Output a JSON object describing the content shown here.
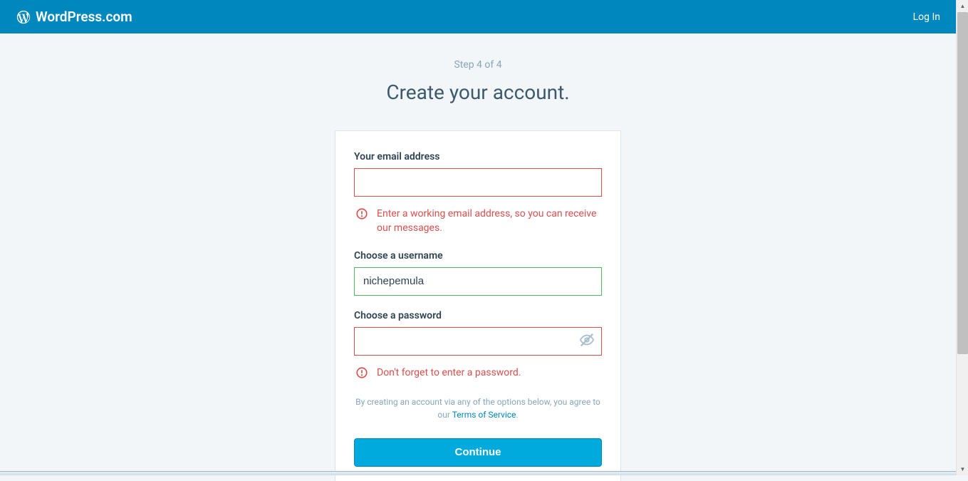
{
  "header": {
    "brand": "WordPress.com",
    "login": "Log In"
  },
  "step": "Step 4 of 4",
  "title": "Create your account.",
  "form": {
    "email": {
      "label": "Your email address",
      "value": "",
      "error": "Enter a working email address, so you can receive our messages."
    },
    "username": {
      "label": "Choose a username",
      "value": "nichepemula"
    },
    "password": {
      "label": "Choose a password",
      "value": "",
      "error": "Don't forget to enter a password."
    }
  },
  "tos": {
    "prefix": "By creating an account via any of the options below, you agree to our ",
    "link": "Terms of Service",
    "suffix": "."
  },
  "continue": "Continue"
}
